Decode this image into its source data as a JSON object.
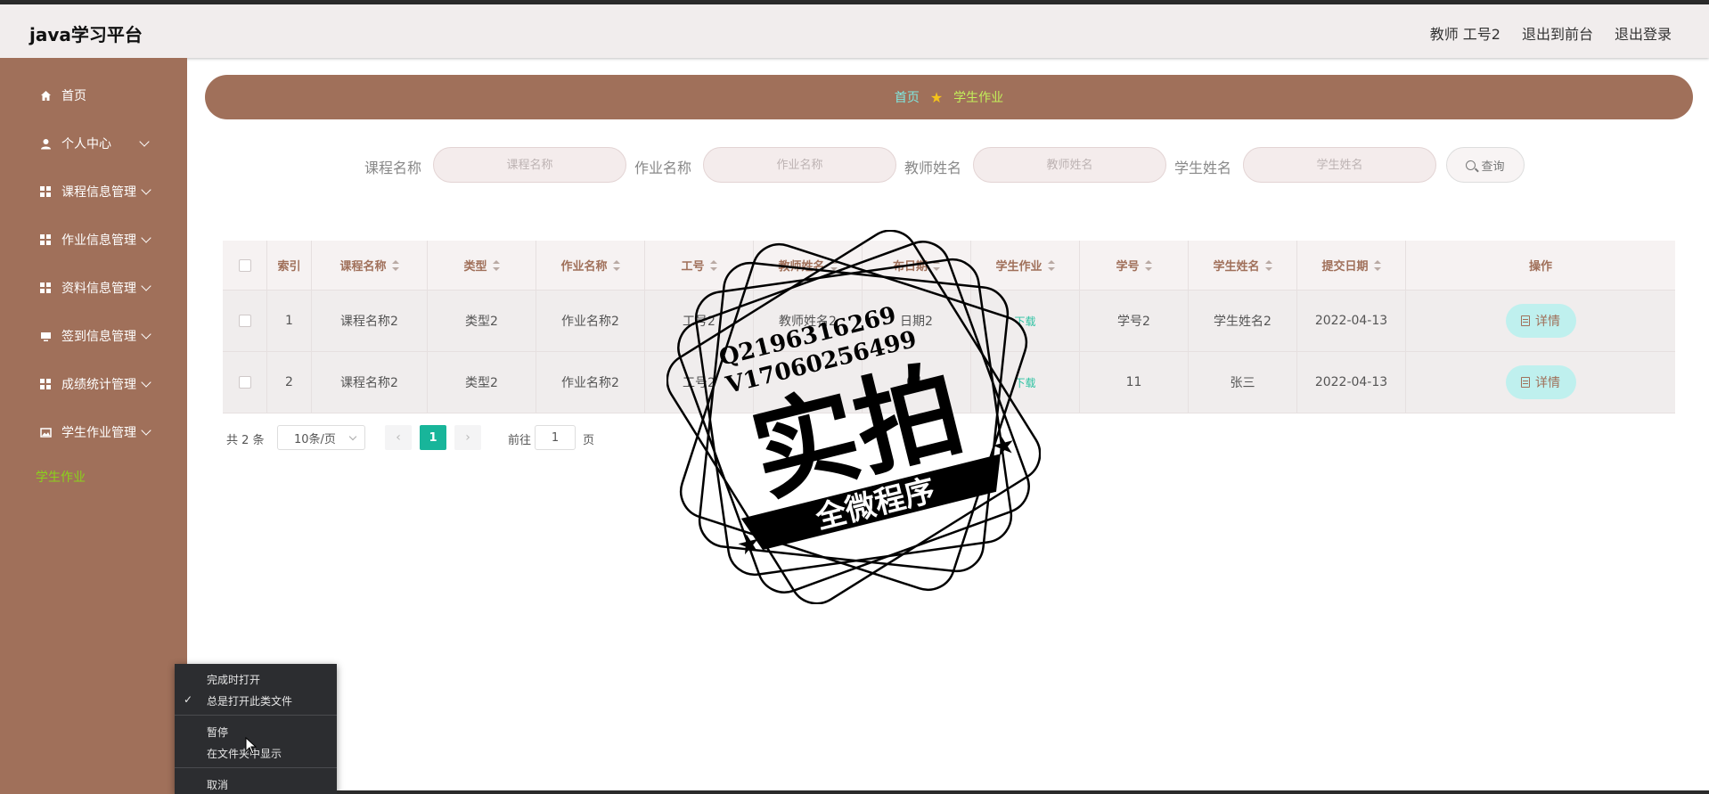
{
  "header": {
    "brand": "java学习平台",
    "user_label": "教师 工号2",
    "back_to_front": "退出到前台",
    "logout": "退出登录"
  },
  "sidebar": {
    "items": [
      {
        "label": "首页",
        "icon": "home-icon"
      },
      {
        "label": "个人中心",
        "icon": "user-icon"
      },
      {
        "label": "课程信息管理",
        "icon": "grid-icon"
      },
      {
        "label": "作业信息管理",
        "icon": "grid-icon"
      },
      {
        "label": "资料信息管理",
        "icon": "grid-icon"
      },
      {
        "label": "签到信息管理",
        "icon": "monitor-icon"
      },
      {
        "label": "成绩统计管理",
        "icon": "grid-icon"
      },
      {
        "label": "学生作业管理",
        "icon": "image-icon"
      }
    ],
    "active_sub": "学生作业"
  },
  "breadcrumb": {
    "home": "首页",
    "current": "学生作业"
  },
  "search": {
    "fields": [
      {
        "label": "课程名称",
        "placeholder": "课程名称"
      },
      {
        "label": "作业名称",
        "placeholder": "作业名称"
      },
      {
        "label": "教师姓名",
        "placeholder": "教师姓名"
      },
      {
        "label": "学生姓名",
        "placeholder": "学生姓名"
      }
    ],
    "button": "查询"
  },
  "table": {
    "headers": [
      "索引",
      "课程名称",
      "类型",
      "作业名称",
      "工号",
      "教师姓名",
      "布日期",
      "学生作业",
      "学号",
      "学生姓名",
      "提交日期",
      "操作"
    ],
    "rows": [
      {
        "index": "1",
        "course": "课程名称2",
        "type": "类型2",
        "homework": "作业名称2",
        "teacher_no": "工号2",
        "teacher_name": "教师姓名2",
        "publish_date": "日期2",
        "student_homework": "下载",
        "student_no": "学号2",
        "student_name": "学生姓名2",
        "submit_date": "2022-04-13",
        "action": "详情"
      },
      {
        "index": "2",
        "course": "课程名称2",
        "type": "类型2",
        "homework": "作业名称2",
        "teacher_no": "工号2",
        "teacher_name": "",
        "publish_date": "04-",
        "student_homework": "下载",
        "student_no": "11",
        "student_name": "张三",
        "submit_date": "2022-04-13",
        "action": "详情"
      }
    ]
  },
  "pager": {
    "total": "共 2 条",
    "page_size": "10条/页",
    "current_page": "1",
    "goto_label": "前往",
    "goto_value": "1",
    "goto_unit": "页"
  },
  "watermark": {
    "line1": "Q2196316269",
    "line2": "V17060256499",
    "big": "实拍",
    "banner": "全微程序"
  },
  "context_menu": {
    "items": [
      "完成时打开",
      "总是打开此类文件",
      "暂停",
      "在文件夹中显示",
      "取消"
    ]
  },
  "colors": {
    "sidebar": "#a0705a",
    "header_bg": "#f1eded",
    "accent_green": "#18b59a",
    "active_sub": "#8bd21c",
    "detail_button": "#bff0ee"
  }
}
